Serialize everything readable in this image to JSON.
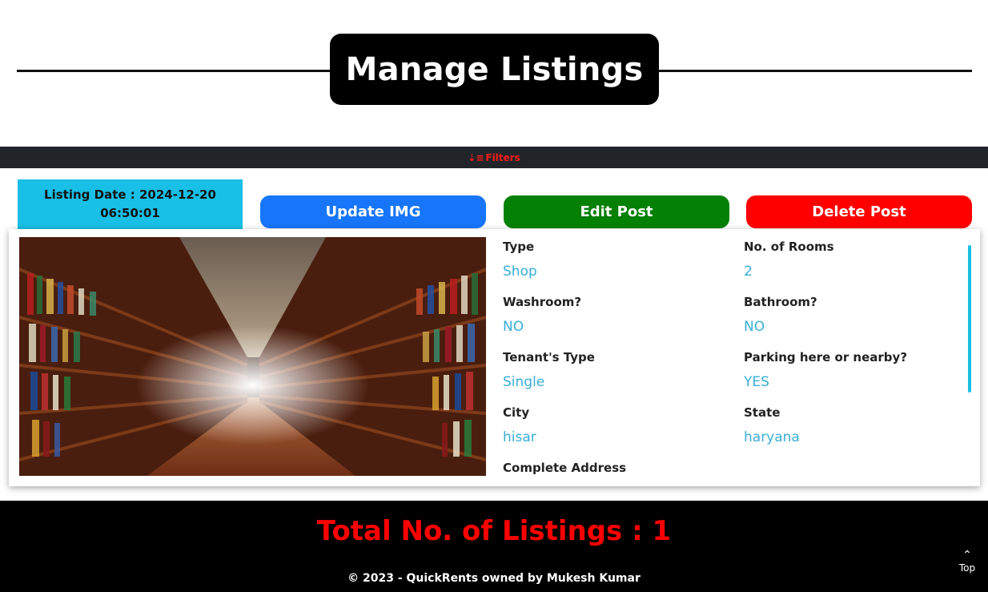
{
  "header": {
    "title": "Manage Listings"
  },
  "filters": {
    "icon": "sort-down-icon",
    "label": "Filters",
    "color": "#ff1a1a"
  },
  "listing": {
    "date_label": "Listing Date : 2024-12-20",
    "date_time": "06:50:01",
    "buttons": {
      "update_img": "Update IMG",
      "edit_post": "Edit Post",
      "delete_post": "Delete Post"
    },
    "fields": {
      "type": {
        "label": "Type",
        "value": "Shop"
      },
      "rooms": {
        "label": "No. of Rooms",
        "value": "2"
      },
      "washroom": {
        "label": "Washroom?",
        "value": "NO"
      },
      "bathroom": {
        "label": "Bathroom?",
        "value": "NO"
      },
      "tenant": {
        "label": "Tenant's Type",
        "value": "Single"
      },
      "parking": {
        "label": "Parking here or nearby?",
        "value": "YES"
      },
      "city": {
        "label": "City",
        "value": "hisar"
      },
      "state": {
        "label": "State",
        "value": "haryana"
      },
      "address": {
        "label": "Complete Address"
      }
    }
  },
  "footer": {
    "total": "Total No. of Listings : 1",
    "copyright": "© 2023 - QuickRents owned by Mukesh Kumar",
    "top_label": "Top"
  },
  "colors": {
    "accent_cyan": "#18bfe6",
    "update_blue": "#1675f8",
    "edit_green": "#048004",
    "delete_red": "#ff0000",
    "value_blue": "#39aed8"
  }
}
